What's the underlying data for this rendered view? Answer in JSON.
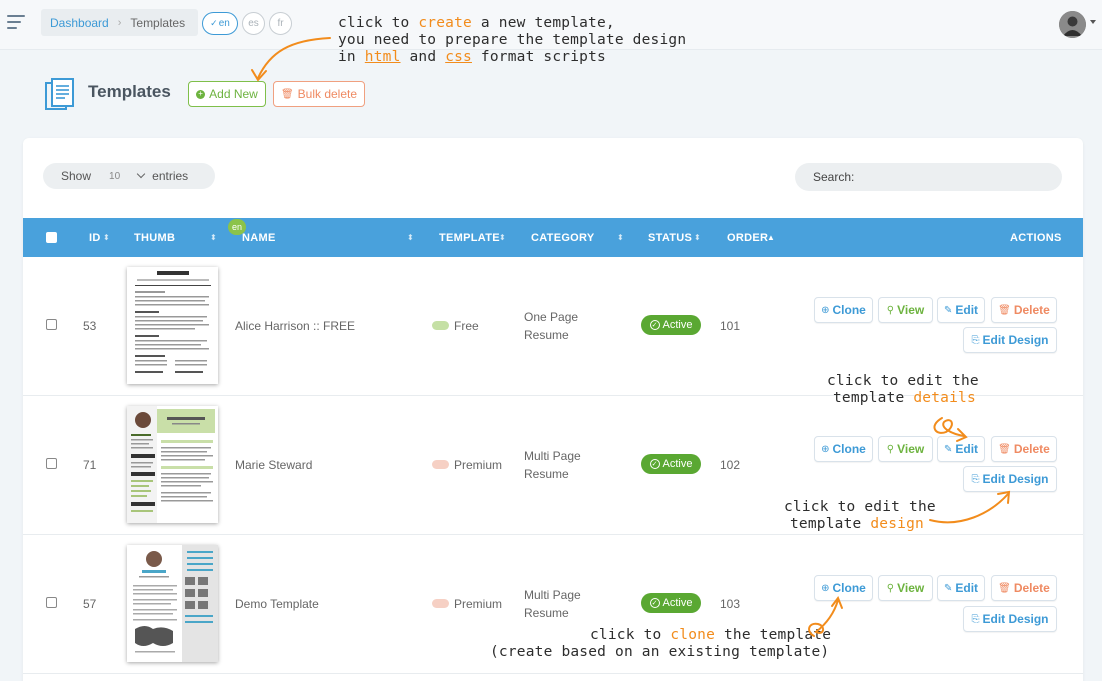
{
  "breadcrumb": {
    "home": "Dashboard",
    "current": "Templates"
  },
  "languages": [
    {
      "code": "en",
      "active": true
    },
    {
      "code": "es",
      "active": false
    },
    {
      "code": "fr",
      "active": false
    }
  ],
  "header": {
    "title": "Templates",
    "add_new": "Add New",
    "bulk_delete": "Bulk delete"
  },
  "table_controls": {
    "show_label": "Show",
    "show_value": "10",
    "entries_label": "entries",
    "search_label": "Search:"
  },
  "columns": {
    "id": "ID",
    "thumb": "THUMB",
    "name": "NAME",
    "template": "TEMPLATE",
    "category": "CATEGORY",
    "status": "STATUS",
    "order": "ORDER",
    "actions": "ACTIONS",
    "lang_badge": "en"
  },
  "rows": [
    {
      "id": "53",
      "name": "Alice Harrison :: FREE",
      "template": "Free",
      "template_color": "#c5e0a5",
      "category": [
        "One Page",
        "Resume"
      ],
      "status": "Active",
      "order": "101"
    },
    {
      "id": "71",
      "name": "Marie Steward",
      "template": "Premium",
      "template_color": "#f6d0c4",
      "category": [
        "Multi Page",
        "Resume"
      ],
      "status": "Active",
      "order": "102"
    },
    {
      "id": "57",
      "name": "Demo Template",
      "template": "Premium",
      "template_color": "#f6d0c4",
      "category": [
        "Multi Page",
        "Resume"
      ],
      "status": "Active",
      "order": "103"
    }
  ],
  "actions": {
    "clone": "Clone",
    "view": "View",
    "edit": "Edit",
    "delete": "Delete",
    "edit_design": "Edit Design"
  },
  "annotations": {
    "create": {
      "l1a": "click to ",
      "l1b": "create",
      "l1c": " a new template,",
      "l2": "you need to prepare the template design",
      "l3a": "in ",
      "l3b": "html",
      "l3c": " and ",
      "l3d": "css",
      "l3e": " format scripts"
    },
    "details": {
      "l1": "click to edit the",
      "l2a": "template ",
      "l2b": "details"
    },
    "design": {
      "l1": "click to edit the",
      "l2a": "template ",
      "l2b": "design"
    },
    "clone": {
      "l1a": "click to ",
      "l1b": "clone",
      "l1c": " the template",
      "l2": "(create based on an existing template)"
    }
  },
  "colors": {
    "accent": "#49a1dc",
    "success": "#5aa832",
    "danger": "#ef8a62",
    "annotation": "#f28c1c"
  }
}
